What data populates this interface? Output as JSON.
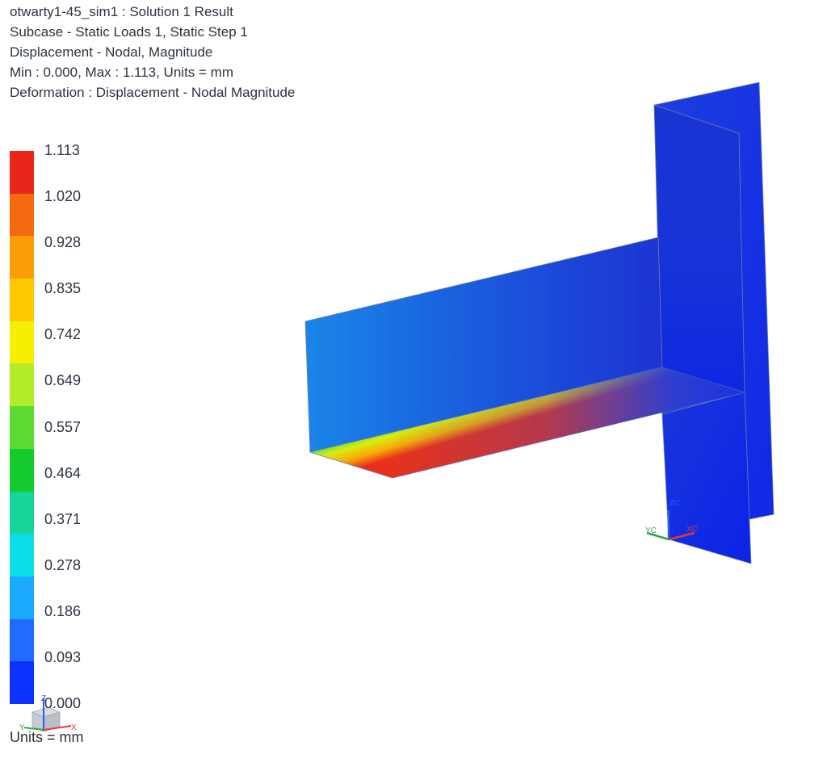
{
  "header": {
    "lines": [
      "otwarty1-45_sim1 : Solution 1 Result",
      "Subcase - Static Loads 1, Static Step 1",
      "Displacement - Nodal, Magnitude",
      "Min : 0.000, Max : 1.113, Units = mm",
      "Deformation : Displacement - Nodal Magnitude"
    ]
  },
  "legend": {
    "ticks": [
      "1.113",
      "1.020",
      "0.928",
      "0.835",
      "0.742",
      "0.649",
      "0.557",
      "0.464",
      "0.371",
      "0.278",
      "0.186",
      "0.093",
      "0.000"
    ],
    "band_colors": [
      "#e8261c",
      "#f36a10",
      "#f99e05",
      "#fdc800",
      "#f6ef00",
      "#b3ec2a",
      "#5cd932",
      "#14cb2d",
      "#16d49a",
      "#0ddde9",
      "#1aa9ff",
      "#1f6cff",
      "#0d31ff"
    ],
    "units": "Units = mm"
  },
  "csys": {
    "zc": "ZC",
    "yc": "YC",
    "xc": "XC",
    "mini_x": "X",
    "mini_y": "Y",
    "mini_z": "Z",
    "colors": {
      "x": "#e23a3a",
      "y": "#33a04a",
      "z": "#2a5bff"
    }
  }
}
